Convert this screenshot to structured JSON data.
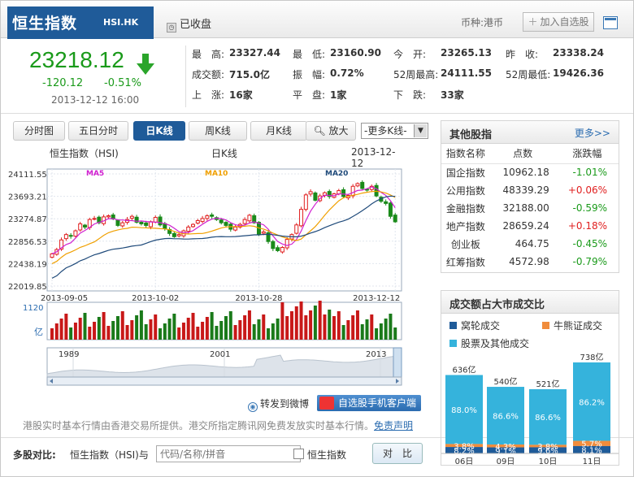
{
  "header": {
    "title": "恒生指数",
    "code": "HSI.HK",
    "status": "已收盘",
    "currency_label": "币种:",
    "currency": "港币",
    "add_watchlist": "加入自选股"
  },
  "quote": {
    "price": "23218.12",
    "change": "-120.12",
    "change_pct": "-0.51%",
    "timestamp": "2013-12-12 16:00"
  },
  "stats": [
    [
      {
        "k": "最　高:",
        "v": "23327.44"
      },
      {
        "k": "最　低:",
        "v": "23160.90"
      },
      {
        "k": "今　开:",
        "v": "23265.13"
      },
      {
        "k": "昨　收:",
        "v": "23338.24"
      }
    ],
    [
      {
        "k": "成交额:",
        "v": "715.0亿"
      },
      {
        "k": "振　幅:",
        "v": "0.72%"
      },
      {
        "k": "52周最高:",
        "v": "24111.55"
      },
      {
        "k": "52周最低:",
        "v": "19426.36"
      }
    ],
    [
      {
        "k": "上　涨:",
        "v": "16家"
      },
      {
        "k": "平　盘:",
        "v": "1家"
      },
      {
        "k": "下　跌:",
        "v": "33家"
      }
    ]
  ],
  "tabs": [
    "分时图",
    "五日分时",
    "日K线",
    "周K线",
    "月K线"
  ],
  "zoom_label": "放大",
  "more_k": "-更多K线-",
  "chart": {
    "name": "恒生指数（HSI)",
    "kind": "日K线",
    "date": "2013-12-12",
    "ma_labels": [
      "MA5",
      "MA10",
      "MA20"
    ],
    "yticks": [
      "24111.55",
      "23693.21",
      "23274.87",
      "22856.53",
      "22438.19",
      "22019.85"
    ],
    "xticks": [
      "2013-09-05",
      "2013-10-02",
      "2013-10-28",
      "2013-12-12"
    ],
    "vol_label": "1120",
    "vol_unit": "亿",
    "overview_ticks": [
      "1989",
      "2001",
      "2013"
    ]
  },
  "share_weibo": "转发到微博",
  "mobile_client": "自选股手机客户端",
  "disclaimer": "港股实时基本行情由香港交易所提供。港交所指定腾讯网免费发放实时基本行情。",
  "disclaimer_link": "免责声明",
  "compare": {
    "label": "多股对比:",
    "current": "恒生指数（HSI)与",
    "placeholder": "代码/名称/拼音",
    "check_label": "恒生指数",
    "button": "对　比"
  },
  "indices": {
    "title": "其他股指",
    "more": "更多>>",
    "headers": [
      "指数名称",
      "点数",
      "涨跌幅"
    ],
    "rows": [
      {
        "name": "国企指数",
        "value": "10962.18",
        "chg": "-1.01%",
        "dir": "dn"
      },
      {
        "name": "公用指数",
        "value": "48339.29",
        "chg": "+0.06%",
        "dir": "up"
      },
      {
        "name": "金融指数",
        "value": "32188.00",
        "chg": "-0.59%",
        "dir": "dn"
      },
      {
        "name": "地产指数",
        "value": "28659.24",
        "chg": "+0.18%",
        "dir": "up"
      },
      {
        "name": "创业板",
        "value": "464.75",
        "chg": "-0.45%",
        "dir": "dn"
      },
      {
        "name": "红筹指数",
        "value": "4572.98",
        "chg": "-0.79%",
        "dir": "dn"
      }
    ]
  },
  "turnover": {
    "title": "成交额占大市成交比",
    "legend": [
      "窝轮成交",
      "牛熊证成交",
      "股票及其他成交"
    ],
    "colors": [
      "#1f5b99",
      "#f08c3c",
      "#35b3dc"
    ],
    "days": [
      {
        "day": "06日",
        "total": "636亿",
        "total_val": 636,
        "stock": 88.0,
        "cbbc": 3.8,
        "warrant": 8.2,
        "stock_l": "88.0%",
        "cbbc_l": "3.8%",
        "warrant_l": "8.2%"
      },
      {
        "day": "09日",
        "total": "540亿",
        "total_val": 540,
        "stock": 86.6,
        "cbbc": 4.3,
        "warrant": 9.1,
        "stock_l": "86.6%",
        "cbbc_l": "4.3%",
        "warrant_l": "9.1%"
      },
      {
        "day": "10日",
        "total": "521亿",
        "total_val": 521,
        "stock": 86.6,
        "cbbc": 3.8,
        "warrant": 9.6,
        "stock_l": "86.6%",
        "cbbc_l": "3.8%",
        "warrant_l": "9.6%"
      },
      {
        "day": "11日",
        "total": "738亿",
        "total_val": 738,
        "stock": 86.2,
        "cbbc": 5.7,
        "warrant": 8.1,
        "stock_l": "86.2%",
        "cbbc_l": "5.7%",
        "warrant_l": "8.1%"
      }
    ]
  },
  "chart_data": [
    {
      "type": "candlestick",
      "title": "恒生指数（HSI)",
      "series_labels": [
        "MA5",
        "MA10",
        "MA20"
      ],
      "ylim": [
        22019.85,
        24111.55
      ],
      "x_ticks": [
        "2013-09-05",
        "2013-10-02",
        "2013-10-28",
        "2013-12-12"
      ],
      "close": [
        22620,
        22700,
        22880,
        22980,
        22950,
        23050,
        23180,
        23120,
        23260,
        23280,
        23200,
        23310,
        23330,
        23270,
        23150,
        23200,
        23260,
        23320,
        23210,
        23180,
        23150,
        23220,
        23300,
        23160,
        23090,
        23000,
        22940,
        22980,
        23050,
        23120,
        23170,
        23240,
        23280,
        23330,
        23320,
        23260,
        23200,
        23150,
        23080,
        23120,
        23170,
        23260,
        23340,
        23200,
        22980,
        23030,
        22850,
        22720,
        22680,
        22740,
        22890,
        22980,
        23160,
        23450,
        23720,
        23780,
        23620,
        23700,
        23760,
        23690,
        23740,
        23800,
        23690,
        23710,
        23880,
        23930,
        23840,
        23820,
        23880,
        23700,
        23600,
        23560,
        23320,
        23218
      ]
    },
    {
      "type": "bar",
      "title": "",
      "ylim": [
        0,
        1120
      ]
    },
    {
      "type": "stacked-bar",
      "title": "成交额占大市成交比",
      "categories": [
        "06日",
        "09日",
        "10日",
        "11日"
      ],
      "series": [
        {
          "name": "窝轮成交",
          "values": [
            8.2,
            9.1,
            9.6,
            8.1
          ]
        },
        {
          "name": "牛熊证成交",
          "values": [
            3.8,
            4.3,
            3.8,
            5.7
          ]
        },
        {
          "name": "股票及其他成交",
          "values": [
            88.0,
            86.6,
            86.6,
            86.2
          ]
        }
      ],
      "totals": [
        "636亿",
        "540亿",
        "521亿",
        "738亿"
      ]
    }
  ]
}
